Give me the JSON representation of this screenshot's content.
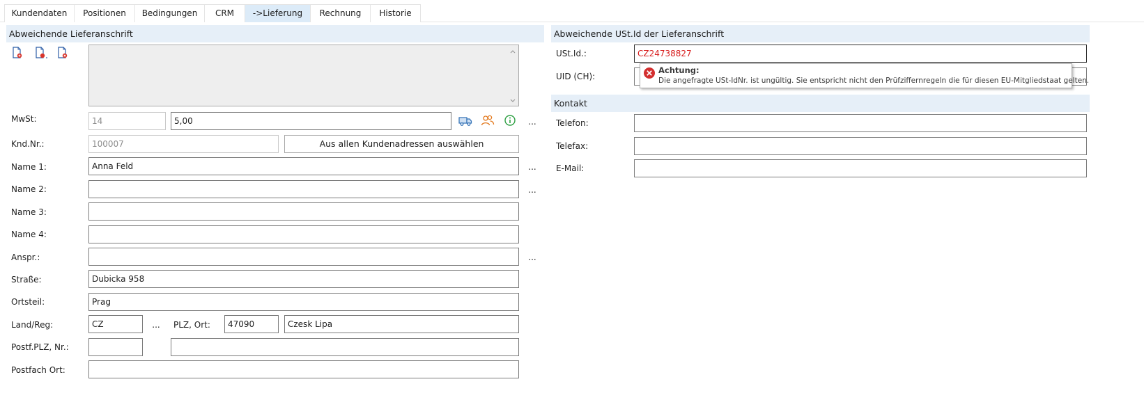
{
  "tabs": [
    "Kundendaten",
    "Positionen",
    "Bedingungen",
    "CRM",
    "->Lieferung",
    "Rechnung",
    "Historie"
  ],
  "left_section": {
    "title": "Abweichende Lieferanschrift",
    "mwst_label": "MwSt:",
    "mwst_code": "14",
    "mwst_rate": "5,00",
    "kndnr_label": "Knd.Nr.:",
    "kndnr_value": "100007",
    "select_button": "Aus allen Kundenadressen auswählen",
    "name1_label": "Name 1:",
    "name1_value": "Anna Feld",
    "name2_label": "Name 2:",
    "name2_value": "",
    "name3_label": "Name 3:",
    "name3_value": "",
    "name4_label": "Name 4:",
    "name4_value": "",
    "anspr_label": "Anspr.:",
    "anspr_value": "",
    "strasse_label": "Straße:",
    "strasse_value": "Dubicka 958",
    "ortsteil_label": "Ortsteil:",
    "ortsteil_value": "Prag",
    "landreg_label": "Land/Reg:",
    "land_value": "CZ",
    "plzort_label": "PLZ, Ort:",
    "plz_value": "47090",
    "ort_value": "Czesk Lipa",
    "postf_label": "Postf.PLZ, Nr.:",
    "postf_plz_value": "",
    "postf_nr_value": "",
    "postfach_ort_label": "Postfach Ort:",
    "postfach_ort_value": "",
    "ellipsis": "..."
  },
  "right_section": {
    "title": "Abweichende USt.Id der Lieferanschrift",
    "ustid_label": "USt.Id.:",
    "ustid_value": "CZ24738827",
    "uid_label": "UID (CH):",
    "uid_value": ""
  },
  "tooltip": {
    "title": "Achtung:",
    "message": "Die angefragte USt-IdNr. ist ungültig. Sie entspricht nicht den Prüfziffernregeln die für diesen EU-Mitgliedstaat gelten."
  },
  "kontakt": {
    "title": "Kontakt",
    "telefon_label": "Telefon:",
    "telefon_value": "",
    "telefax_label": "Telefax:",
    "telefax_value": "",
    "email_label": "E-Mail:",
    "email_value": ""
  },
  "icons": [
    "document-add-icon",
    "document-edit-icon",
    "document-delete-icon",
    "truck-icon",
    "contacts-icon",
    "info-icon",
    "error-icon"
  ],
  "colors": {
    "tab_active": "#dcebf8",
    "section_header": "#e6eff8",
    "error_text": "#d81e1e",
    "error_icon": "#d32f2f",
    "truck_icon": "#2f6fb5",
    "contacts_icon": "#e3791e",
    "info_icon": "#2ea043"
  }
}
